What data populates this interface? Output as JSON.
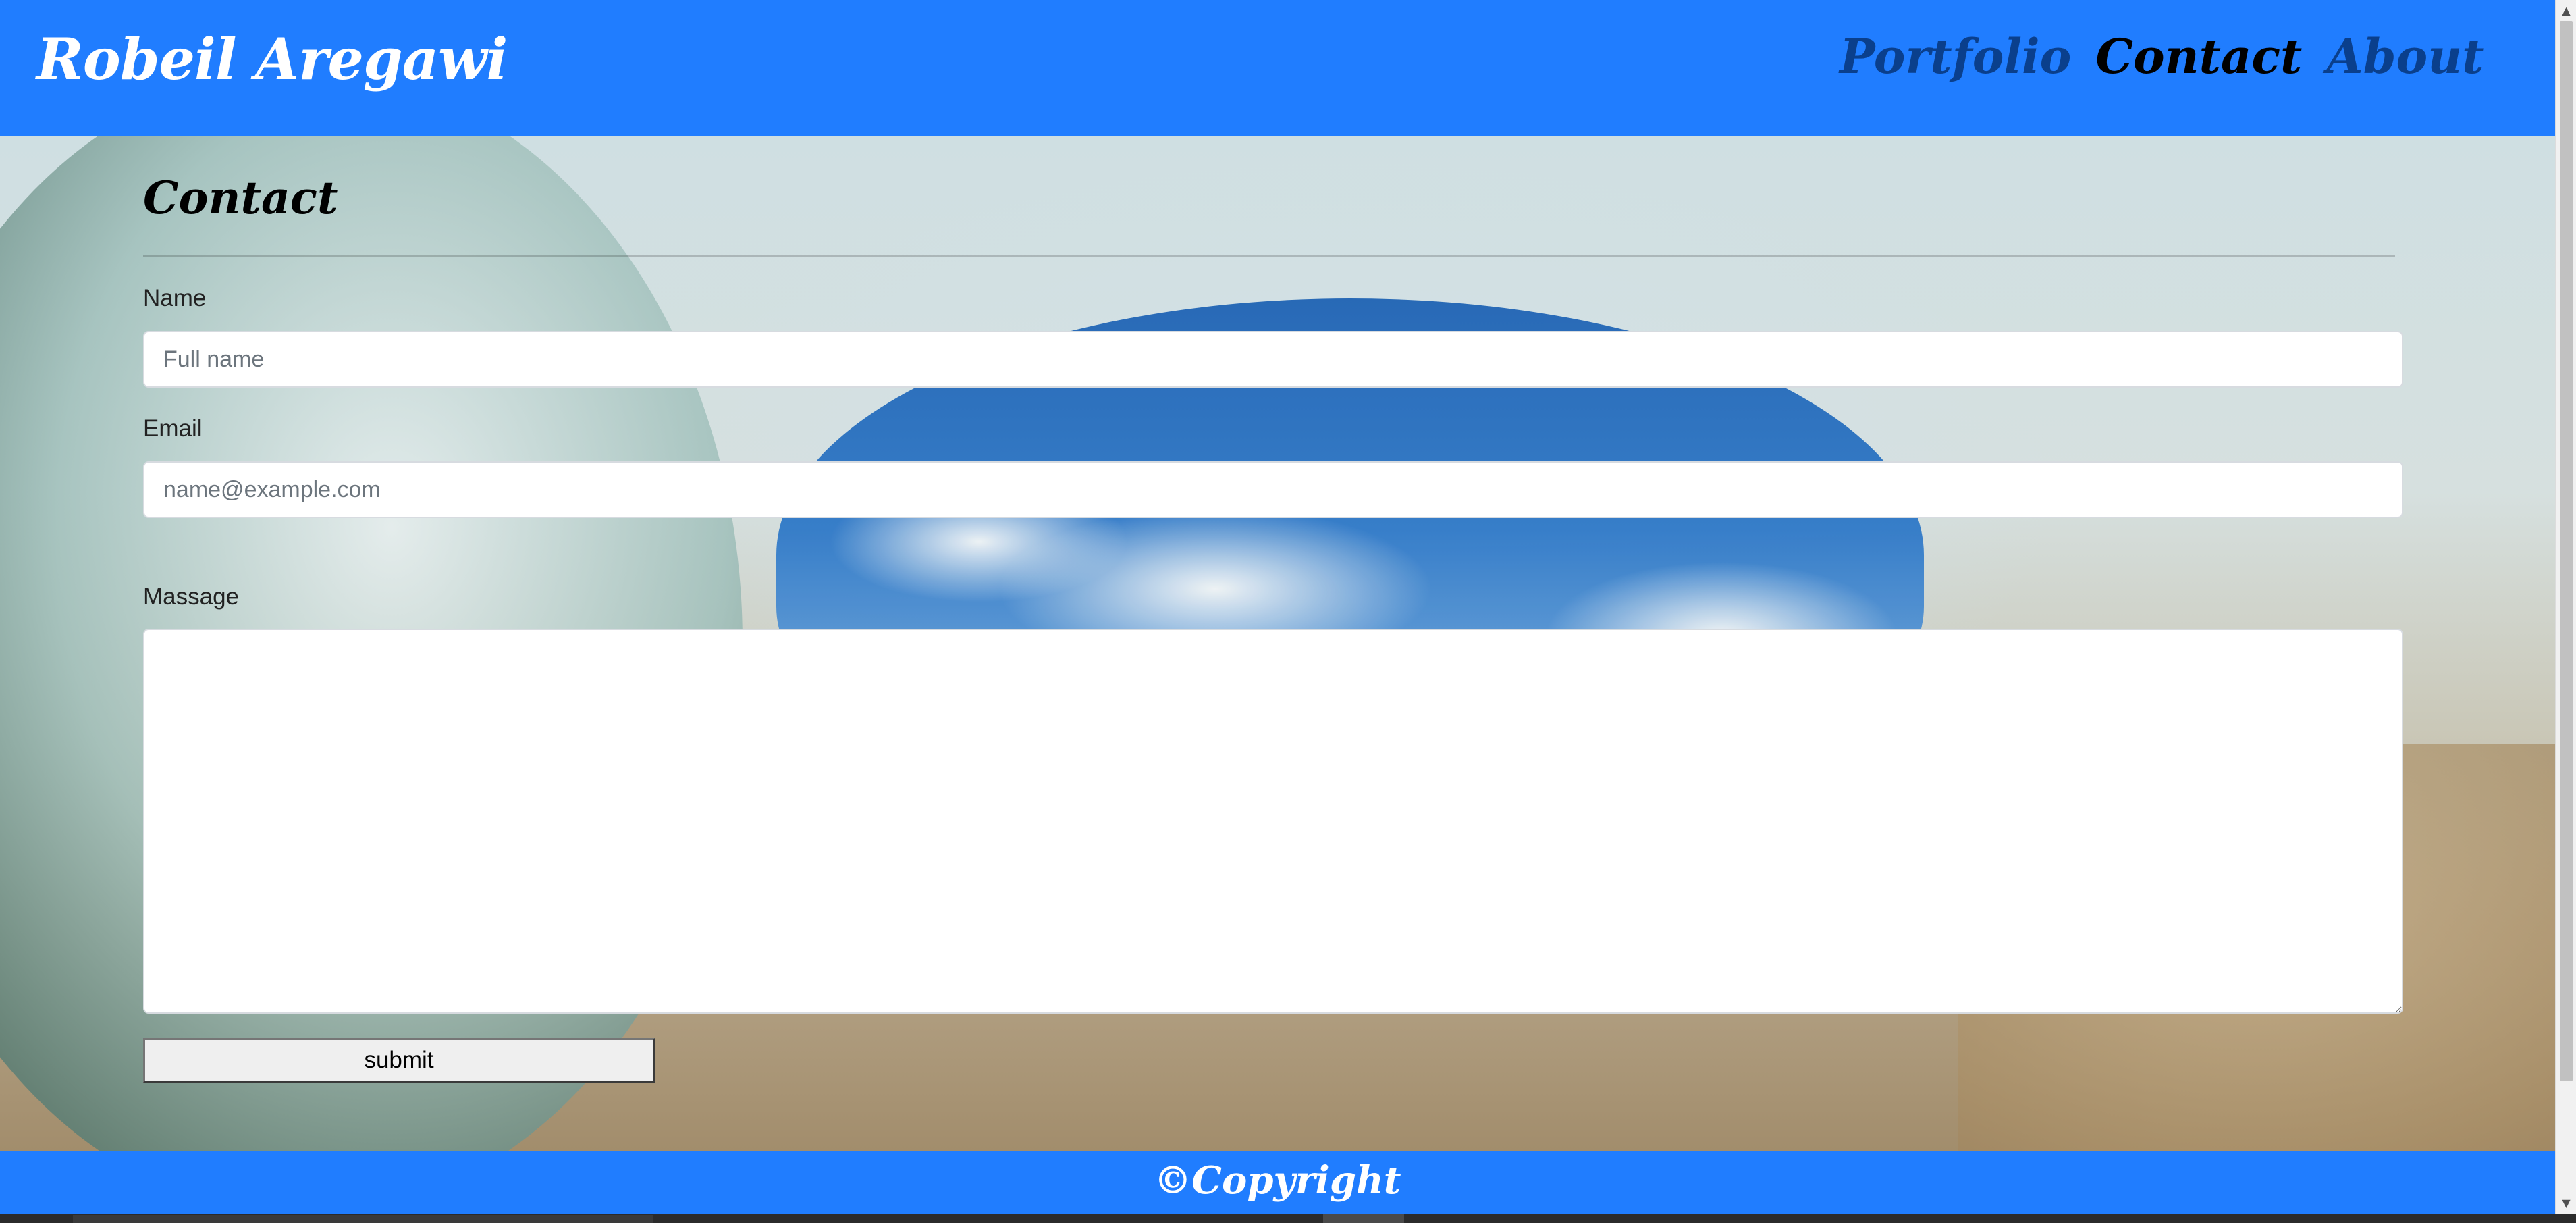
{
  "header": {
    "brand": "Robeil Aregawi",
    "nav": [
      {
        "label": "Portfolio",
        "active": false
      },
      {
        "label": "Contact",
        "active": true
      },
      {
        "label": "About",
        "active": false
      }
    ],
    "background_color": "#207dff"
  },
  "main": {
    "title": "Contact",
    "form": {
      "name_label": "Name",
      "name_placeholder": "Full name",
      "email_label": "Email",
      "email_placeholder": "name@example.com",
      "message_label": "Massage",
      "submit_label": "submit"
    }
  },
  "footer": {
    "copyright": "©Copyright",
    "background_color": "#207dff"
  },
  "icons": {
    "scroll_up": "chevron-up-icon",
    "scroll_down": "chevron-down-icon"
  }
}
